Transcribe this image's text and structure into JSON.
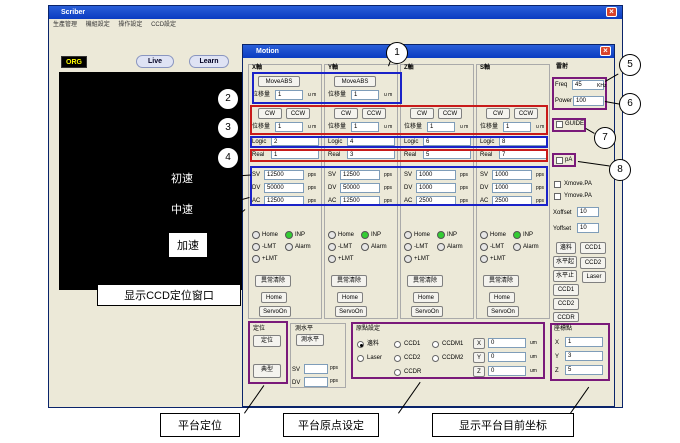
{
  "window": {
    "title": "Scriber",
    "menu": [
      "生產管理",
      "機組設定",
      "操作設定",
      "CCD設定"
    ]
  },
  "left": {
    "org": "ORG",
    "live": "Live",
    "learn": "Learn"
  },
  "motion": {
    "title": "Motion",
    "axes": [
      {
        "label": "X軸",
        "move_abs": "MoveABS",
        "move_unit": "u m",
        "move_value": "1",
        "cw": "CW",
        "ccw": "CCW",
        "shift_label": "位移量",
        "shift_value": "1",
        "logic_label": "Logic",
        "logic": "2",
        "real_label": "Real",
        "real": "1",
        "sv": "12500",
        "dv": "50000",
        "ac": "12500",
        "unit": "pps"
      },
      {
        "label": "Y軸",
        "move_abs": "MoveABS",
        "move_unit": "u m",
        "move_value": "1",
        "cw": "CW",
        "ccw": "CCW",
        "shift_label": "位移量",
        "shift_value": "1",
        "logic_label": "Logic",
        "logic": "4",
        "real_label": "Real",
        "real": "3",
        "sv": "12500",
        "dv": "50000",
        "ac": "12500",
        "unit": "pps"
      },
      {
        "label": "Z軸",
        "cw": "CW",
        "ccw": "CCW",
        "shift_label": "位移量",
        "shift_value": "1",
        "logic_label": "Logic",
        "logic": "6",
        "real_label": "Real",
        "real": "5",
        "sv": "1000",
        "dv": "1000",
        "ac": "2500",
        "unit": "pps"
      },
      {
        "label": "S軸",
        "cw": "CW",
        "ccw": "CCW",
        "shift_label": "位移量",
        "shift_value": "1",
        "logic_label": "Logic",
        "logic": "8",
        "real_label": "Real",
        "real": "7",
        "sv": "1000",
        "dv": "1000",
        "ac": "2500",
        "unit": "pps"
      }
    ],
    "shift_unit": "u m",
    "sv_label": "SV",
    "dv_label": "DV",
    "ac_label": "AC",
    "status": {
      "home": "Home",
      "inp": "INP",
      "mlmt": "-LMT",
      "alarm": "Alarm",
      "plmt": "+LMT"
    },
    "actions": {
      "clear": "異常清除",
      "home": "Home",
      "servo": "ServoOn"
    },
    "laser": {
      "title": "雷射",
      "freq_label": "Freq",
      "freq": "45",
      "freq_unit": "KHz",
      "power_label": "Power",
      "power": "100",
      "guide": "GUIDE",
      "pa": "pA",
      "xmove": "Xmove.PA",
      "ymove": "Ymove.PA",
      "xoffset_label": "Xoffset",
      "xoffset": "10",
      "yoffset_label": "Yoffset",
      "yoffset": "10"
    },
    "side_buttons": [
      "邊料",
      "CCD1",
      "水平起",
      "CCD2",
      "水平止",
      "Laser",
      "CCD1",
      "CCD2",
      "CCDR"
    ],
    "position": {
      "title": "定位",
      "btn": "定位",
      "typical": "典型"
    },
    "level": {
      "title": "測水平",
      "btn": "測水平",
      "sv_label": "SV",
      "dv_label": "DV",
      "unit": "pps"
    },
    "origin": {
      "title": "原點設定",
      "options": [
        "邊料",
        "CCD1",
        "CCDM1",
        "Laser",
        "CCD2",
        "CCDM2",
        "CCDR"
      ],
      "x": "X",
      "y": "Y",
      "z": "Z",
      "xv": "0",
      "yv": "0",
      "zv": "0",
      "unit": "um"
    },
    "coords": {
      "title": "座標點",
      "x_label": "X",
      "x": "1",
      "y_label": "Y",
      "y": "3",
      "z_label": "Z",
      "z": "5"
    }
  },
  "annotations": {
    "n1": "1",
    "n2": "2",
    "n3": "3",
    "n4": "4",
    "n5": "5",
    "n6": "6",
    "n7": "7",
    "n8": "8",
    "init_speed": "初速",
    "mid_speed": "中速",
    "accel": "加速",
    "ccd_window": "显示CCD定位窗口",
    "platform_pos": "平台定位",
    "platform_origin": "平台原点设定",
    "platform_coords": "显示平台目前坐标"
  }
}
